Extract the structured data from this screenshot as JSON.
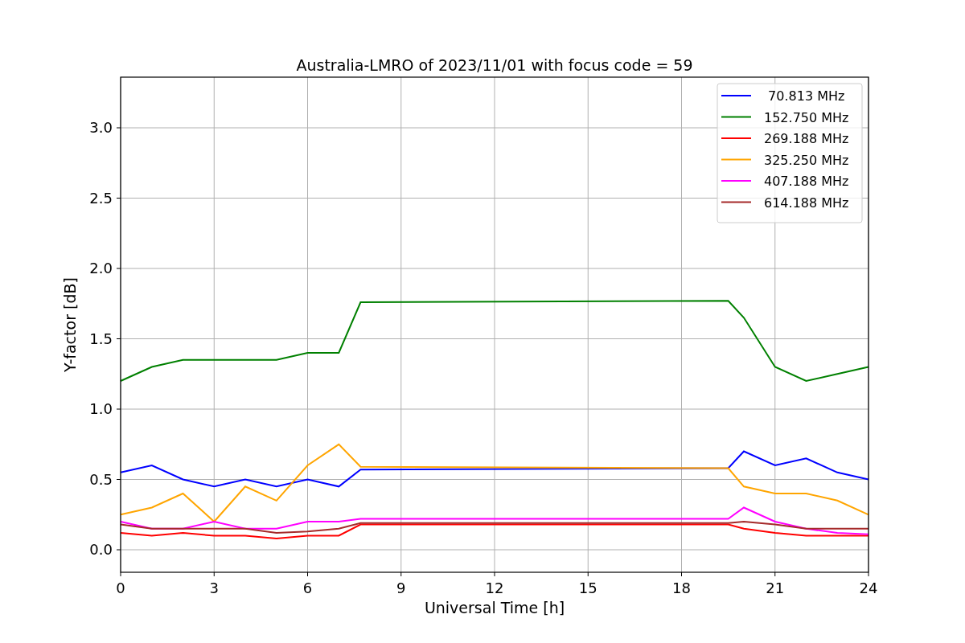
{
  "chart_data": {
    "type": "line",
    "grid": true,
    "legend": true,
    "title": "Australia-LMRO of 2023/11/01 with focus code = 59",
    "xlabel": "Universal Time [h]",
    "ylabel": "Y-factor [dB]",
    "x": [
      0,
      1,
      2,
      3,
      4,
      5,
      6,
      7,
      7.7,
      19.5,
      20,
      21,
      22,
      23,
      24
    ],
    "series": [
      {
        "name": " 70.813 MHz",
        "color": "#0000ff",
        "values": [
          0.55,
          0.6,
          0.5,
          0.45,
          0.5,
          0.45,
          0.5,
          0.45,
          0.57,
          0.58,
          0.7,
          0.6,
          0.65,
          0.55,
          0.5
        ]
      },
      {
        "name": "152.750 MHz",
        "color": "#008000",
        "values": [
          1.2,
          1.3,
          1.35,
          1.35,
          1.35,
          1.35,
          1.4,
          1.4,
          1.76,
          1.77,
          1.65,
          1.3,
          1.2,
          1.25,
          1.3
        ]
      },
      {
        "name": "269.188 MHz",
        "color": "#ff0000",
        "values": [
          0.12,
          0.1,
          0.12,
          0.1,
          0.1,
          0.08,
          0.1,
          0.1,
          0.18,
          0.18,
          0.15,
          0.12,
          0.1,
          0.1,
          0.1
        ]
      },
      {
        "name": "325.250 MHz",
        "color": "#ffa500",
        "values": [
          0.25,
          0.3,
          0.4,
          0.2,
          0.45,
          0.35,
          0.6,
          0.75,
          0.59,
          0.58,
          0.45,
          0.4,
          0.4,
          0.35,
          0.25
        ]
      },
      {
        "name": "407.188 MHz",
        "color": "#ff00ff",
        "values": [
          0.2,
          0.15,
          0.15,
          0.2,
          0.15,
          0.15,
          0.2,
          0.2,
          0.22,
          0.22,
          0.3,
          0.2,
          0.15,
          0.12,
          0.11
        ]
      },
      {
        "name": "614.188 MHz",
        "color": "#a52a2a",
        "values": [
          0.18,
          0.15,
          0.15,
          0.15,
          0.15,
          0.12,
          0.13,
          0.15,
          0.19,
          0.19,
          0.2,
          0.18,
          0.15,
          0.15,
          0.15
        ]
      }
    ],
    "xlim": [
      0,
      24
    ],
    "ylim": [
      -0.16,
      3.36
    ],
    "xticks": [
      0,
      3,
      6,
      9,
      12,
      15,
      18,
      21,
      24
    ],
    "yticks": [
      {
        "value": 0,
        "label": "0.0"
      },
      {
        "value": 0.5,
        "label": "0.5"
      },
      {
        "value": 1,
        "label": "1.0"
      },
      {
        "value": 1.5,
        "label": "1.5"
      },
      {
        "value": 2,
        "label": "2.0"
      },
      {
        "value": 2.5,
        "label": "2.5"
      },
      {
        "value": 3,
        "label": "3.0"
      }
    ]
  }
}
